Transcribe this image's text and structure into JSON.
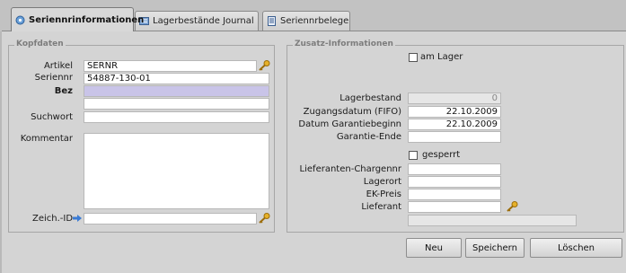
{
  "tabs": [
    {
      "label": "Seriennrinformationen",
      "active": true,
      "icon": "serial-info-icon"
    },
    {
      "label": "Lagerbestände Journal",
      "active": false,
      "icon": "journal-icon"
    },
    {
      "label": "Seriennrbelege",
      "active": false,
      "icon": "document-icon"
    }
  ],
  "kopfdaten": {
    "title": "Kopfdaten",
    "artikel_label": "Artikel",
    "artikel_value": "SERNR",
    "seriennr_label": "Seriennr",
    "seriennr_value": "54887-130-01",
    "bez_label": "Bez",
    "bez_value": "",
    "bez2_value": "",
    "suchwort_label": "Suchwort",
    "suchwort_value": "",
    "kommentar_label": "Kommentar",
    "kommentar_value": "",
    "zeichid_label": "Zeich.-ID",
    "zeichid_value": ""
  },
  "zusatz": {
    "title": "Zusatz-Informationen",
    "am_lager_label": "am Lager",
    "am_lager_checked": false,
    "lagerbestand_label": "Lagerbestand",
    "lagerbestand_value": "0",
    "zugangsdatum_label": "Zugangsdatum (FIFO)",
    "zugangsdatum_value": "22.10.2009",
    "garantiebeginn_label": "Datum Garantiebeginn",
    "garantiebeginn_value": "22.10.2009",
    "garantieende_label": "Garantie-Ende",
    "garantieende_value": "",
    "gesperrt_label": "gesperrt",
    "gesperrt_checked": false,
    "chargennr_label": "Lieferanten-Chargennr",
    "chargennr_value": "",
    "lagerort_label": "Lagerort",
    "lagerort_value": "",
    "ekpreis_label": "EK-Preis",
    "ekpreis_value": "",
    "lieferant_label": "Lieferant",
    "lieferant_value": "",
    "lieferant_name_value": ""
  },
  "buttons": {
    "neu": "Neu",
    "speichern": "Speichern",
    "loeschen": "Löschen"
  },
  "colors": {
    "accent_highlight": "#c9c4e8",
    "key_icon": "#d9a21b",
    "arrow_icon": "#3a7bd5"
  }
}
